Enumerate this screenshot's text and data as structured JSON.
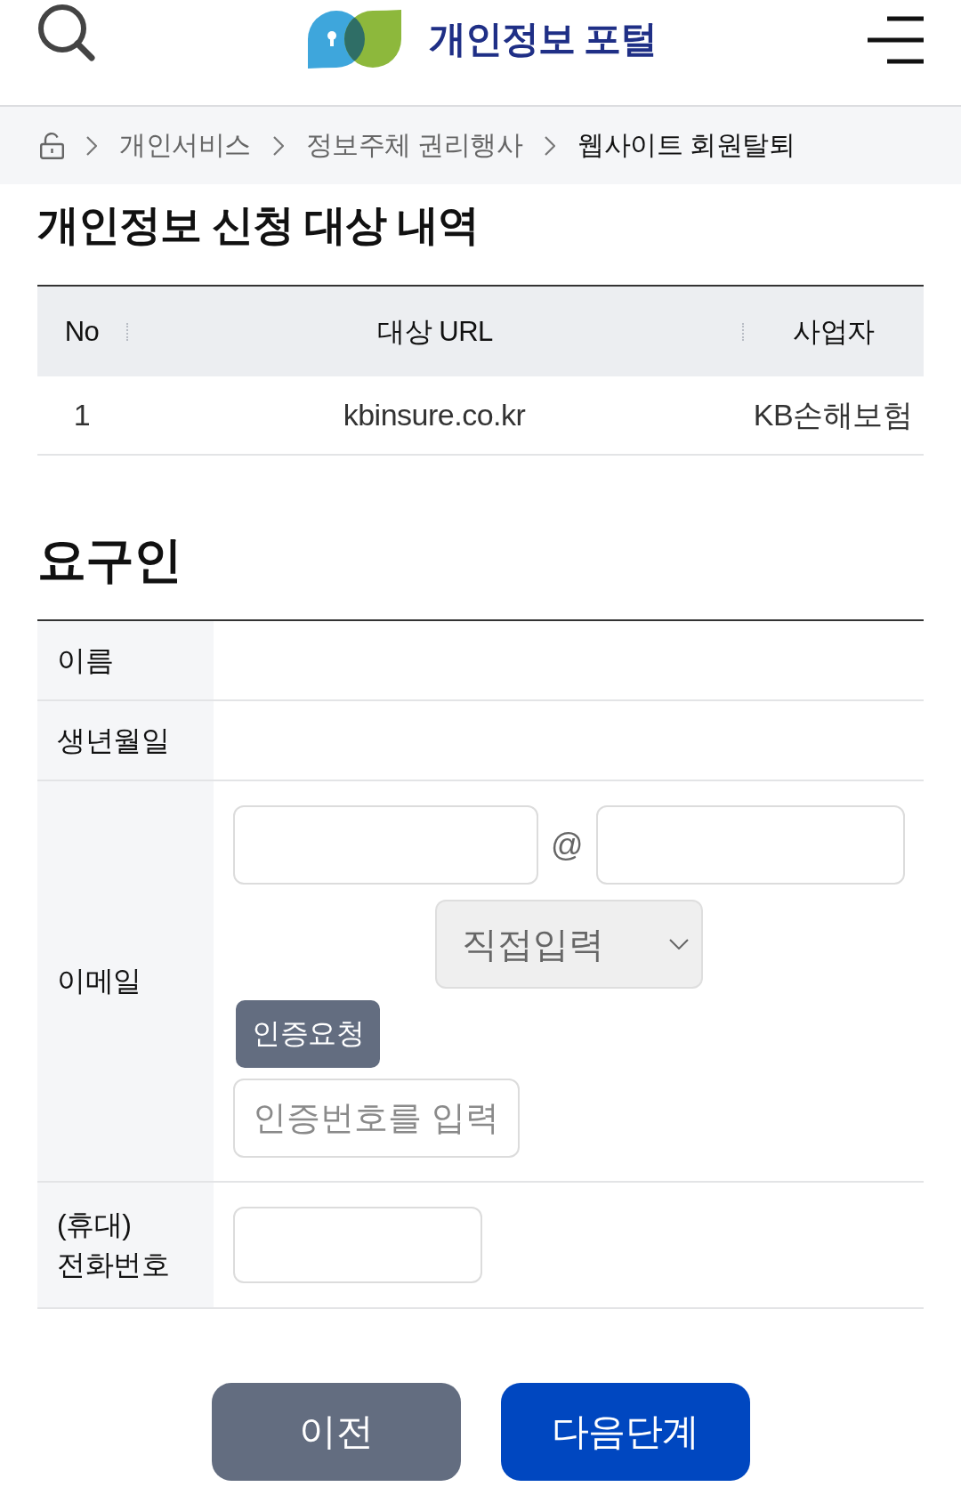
{
  "header": {
    "logo_text": "개인정보 포털"
  },
  "breadcrumb": [
    {
      "label": "개인서비스",
      "current": false
    },
    {
      "label": "정보주체 권리행사",
      "current": false
    },
    {
      "label": "웹사이트 회원탈퇴",
      "current": true
    }
  ],
  "target_section": {
    "title": "개인정보 신청 대상 내역",
    "table": {
      "columns": [
        "No",
        "대상 URL",
        "사업자"
      ],
      "rows": [
        [
          "1",
          "kbinsure.co.kr",
          "KB손해보험"
        ]
      ]
    }
  },
  "requester_section": {
    "title": "요구인",
    "fields": [
      {
        "kind": "readonly",
        "label": "이름"
      },
      {
        "kind": "readonly",
        "label": "생년월일"
      },
      {
        "kind": "email",
        "label": "이메일",
        "separator": "@",
        "domain_select": {
          "value": "직접입력"
        },
        "verify_button": "인증요청",
        "code_field": {
          "placeholder": "인증번호를 입력"
        }
      },
      {
        "kind": "phone",
        "label": "(휴대) 전화번호"
      }
    ]
  },
  "buttons": [
    {
      "kind": "secondary",
      "label": "이전"
    },
    {
      "kind": "primary",
      "label": "다음단계"
    }
  ]
}
